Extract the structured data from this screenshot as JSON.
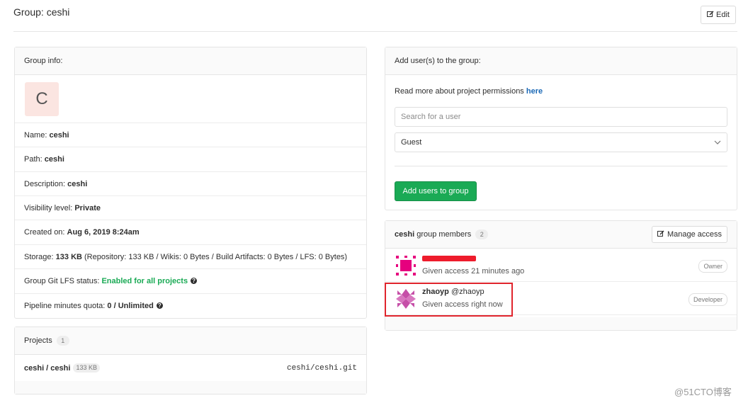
{
  "header": {
    "title": "Group: ceshi",
    "edit_label": "Edit"
  },
  "group_info": {
    "heading": "Group info:",
    "avatar_letter": "C",
    "rows": {
      "name_label": "Name:",
      "name_value": "ceshi",
      "path_label": "Path:",
      "path_value": "ceshi",
      "description_label": "Description:",
      "description_value": "ceshi",
      "visibility_label": "Visibility level:",
      "visibility_value": "Private",
      "created_label": "Created on:",
      "created_value": "Aug 6, 2019 8:24am",
      "storage_label": "Storage:",
      "storage_value": "133 KB",
      "storage_detail": "(Repository: 133 KB / Wikis: 0 Bytes / Build Artifacts: 0 Bytes / LFS: 0 Bytes)",
      "lfs_label": "Group Git LFS status:",
      "lfs_value": "Enabled for all projects",
      "pipeline_label": "Pipeline minutes quota:",
      "pipeline_value": "0 / Unlimited"
    }
  },
  "projects": {
    "heading": "Projects",
    "count": "1",
    "items": [
      {
        "name": "ceshi / ceshi",
        "size": "133 KB",
        "repo": "ceshi/ceshi.git"
      }
    ]
  },
  "add_users": {
    "heading": "Add user(s) to the group:",
    "permissions_text": "Read more about project permissions",
    "permissions_link": "here",
    "search_placeholder": "Search for a user",
    "role_selected": "Guest",
    "submit_label": "Add users to group"
  },
  "members": {
    "group_name": "ceshi",
    "heading_suffix": "group members",
    "count": "2",
    "manage_label": "Manage access",
    "items": [
      {
        "name": "",
        "handle": "",
        "access": "Given access 21 minutes ago",
        "role": "Owner"
      },
      {
        "name": "zhaoyp",
        "handle": "@zhaoyp",
        "access": "Given access right now",
        "role": "Developer"
      }
    ]
  },
  "watermark": "@51CTO博客",
  "colors": {
    "primary_green": "#1aaa55",
    "link_blue": "#1b69b6",
    "highlight_red": "#e0252d",
    "redaction_red": "#ee1c2c"
  },
  "icons": {
    "edit": "pencil-square-icon",
    "help": "question-circle-icon",
    "select": "chevron-down-icon"
  }
}
